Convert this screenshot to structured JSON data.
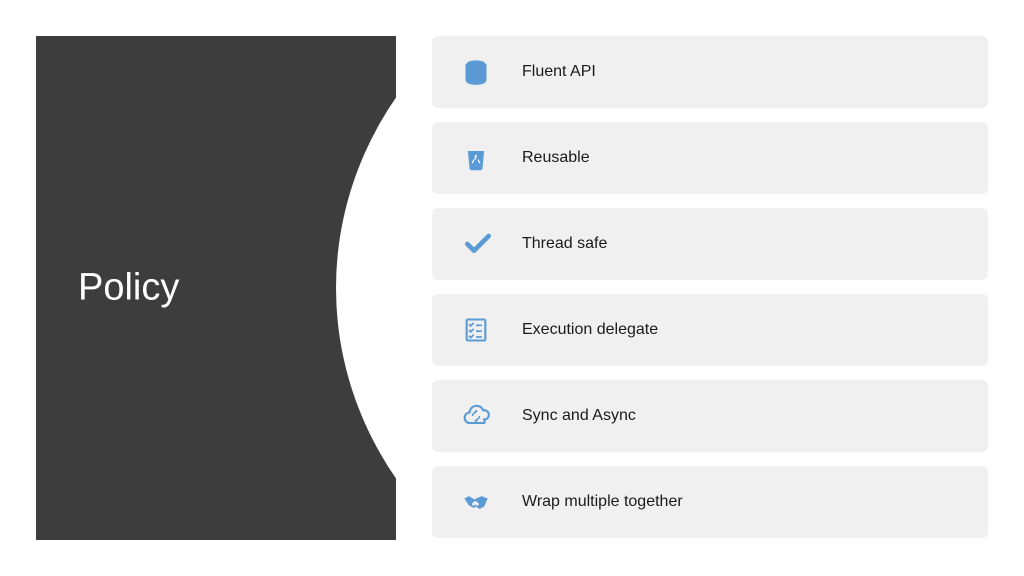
{
  "title": "Policy",
  "features": [
    {
      "label": "Fluent API",
      "icon": "database-icon"
    },
    {
      "label": "Reusable",
      "icon": "recycle-bin-icon"
    },
    {
      "label": "Thread safe",
      "icon": "checkmark-icon"
    },
    {
      "label": "Execution delegate",
      "icon": "checklist-icon"
    },
    {
      "label": "Sync and Async",
      "icon": "cloud-sync-icon"
    },
    {
      "label": "Wrap multiple together",
      "icon": "handshake-icon"
    }
  ],
  "colors": {
    "panel": "#3d3d3d",
    "card": "#f0f0f0",
    "accent": "#5b9bd5"
  }
}
